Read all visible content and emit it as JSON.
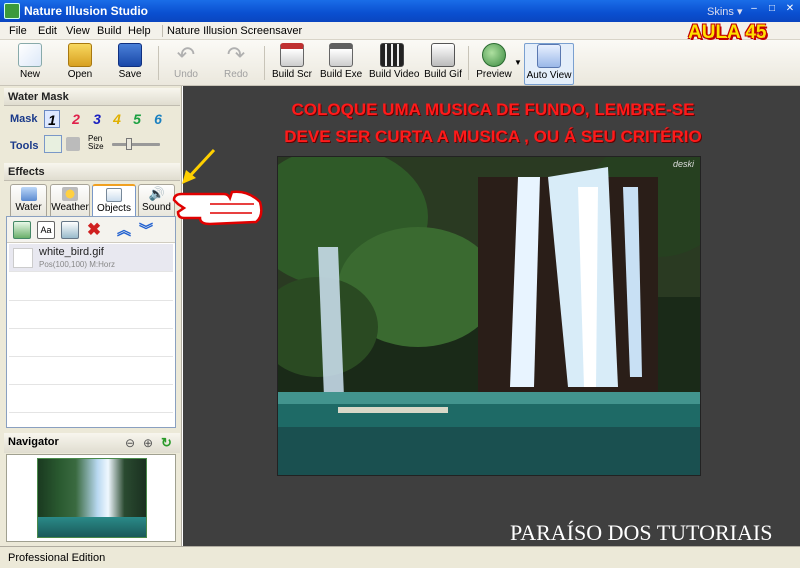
{
  "window": {
    "title": "Nature Illusion Studio",
    "skins": "Skins ▾",
    "min": "–",
    "max": "□",
    "close": "✕"
  },
  "menu": {
    "items": [
      "File",
      "Edit",
      "View",
      "Build",
      "Help"
    ],
    "extra": "Nature Illusion Screensaver"
  },
  "toolbar": {
    "new": "New",
    "open": "Open",
    "save": "Save",
    "undo": "Undo",
    "redo": "Redo",
    "build_scr": "Build Scr",
    "build_exe": "Build Exe",
    "build_video": "Build Video",
    "build_gif": "Build Gif",
    "preview": "Preview",
    "auto_view": "Auto View"
  },
  "watermask": {
    "title": "Water Mask",
    "mask_label": "Mask",
    "tools_label": "Tools",
    "pen_size": "Pen\nSize",
    "numbers": [
      "1",
      "2",
      "3",
      "4",
      "5",
      "6"
    ]
  },
  "effects": {
    "title": "Effects",
    "tabs": [
      "Water",
      "Weather",
      "Objects",
      "Sound"
    ]
  },
  "objects": {
    "items": [
      {
        "name": "white_bird.gif",
        "detail": "Pos(100,100) M:Horz"
      }
    ],
    "text_button": "Aa"
  },
  "navigator": {
    "title": "Navigator"
  },
  "status": {
    "text": "Professional Edition"
  },
  "overlay": {
    "line1": "COLOQUE UMA MUSICA DE FUNDO, LEMBRE-SE",
    "line2": "DEVE SER CURTA A MUSICA , OU Á SEU CRITÉRIO",
    "aula": "AULA 45",
    "footer": "PARAÍSO DOS TUTORIAIS",
    "watermark": "deski"
  },
  "colors": {
    "mask": [
      "#1a1a8a",
      "#e0204a",
      "#1a20c0",
      "#e0b000",
      "#1aa040",
      "#1a80c0"
    ],
    "overlay_text": "#ff1a1a",
    "aula": "#ffe000"
  }
}
